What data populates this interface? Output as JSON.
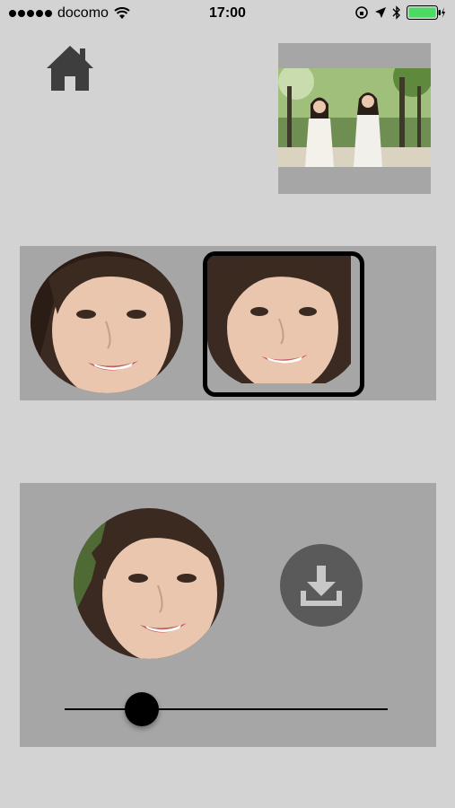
{
  "status_bar": {
    "carrier": "docomo",
    "time": "17:00",
    "battery_color": "#4cd964"
  },
  "home": {
    "icon": "home-icon"
  },
  "thumbnail": {
    "description": "two-girls-in-forest"
  },
  "shape_options": [
    {
      "shape": "oval",
      "selected": false
    },
    {
      "shape": "rounded-square",
      "selected": true
    }
  ],
  "preview": {
    "shape": "circle",
    "download_icon": "download-icon"
  },
  "slider": {
    "value": 0.24
  },
  "colors": {
    "background": "#d3d3d3",
    "panel": "#a6a6a6",
    "button": "#5a5a5a"
  }
}
